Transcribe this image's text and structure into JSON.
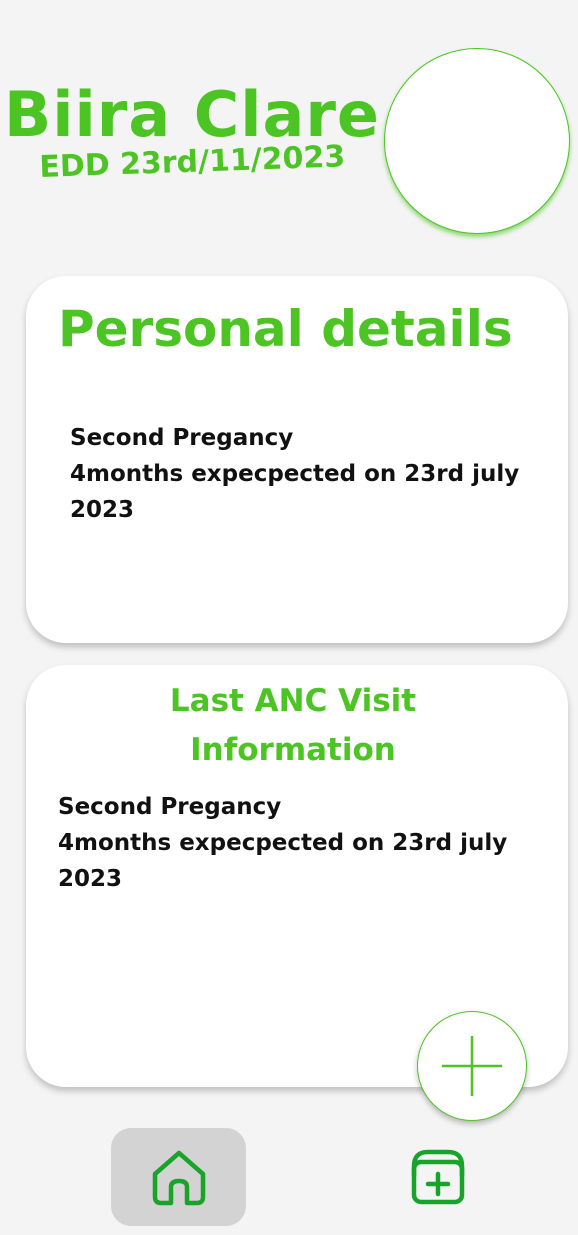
{
  "profile": {
    "name": "Biira Clare",
    "edd": "EDD 23rd/11/2023"
  },
  "personal_card": {
    "title": "Personal details",
    "line1": "Second Pregancy",
    "line2": "4months expecpected on 23rd july",
    "line3": "2023"
  },
  "anc_card": {
    "title_line1": "Last ANC Visit",
    "title_line2": "Information",
    "line1": "Second Pregancy",
    "line2": "4months expecpected on 23rd july",
    "line3": "2023"
  },
  "fab": {
    "icon": "plus-icon"
  },
  "bottom_nav": {
    "items": [
      {
        "icon": "home-icon",
        "active": true
      },
      {
        "icon": "clinic-bag-icon",
        "active": false
      }
    ]
  },
  "colors": {
    "accent": "#4cc423",
    "nav_active_bg": "#d3d3d3",
    "background": "#f4f4f4",
    "card": "#ffffff"
  }
}
